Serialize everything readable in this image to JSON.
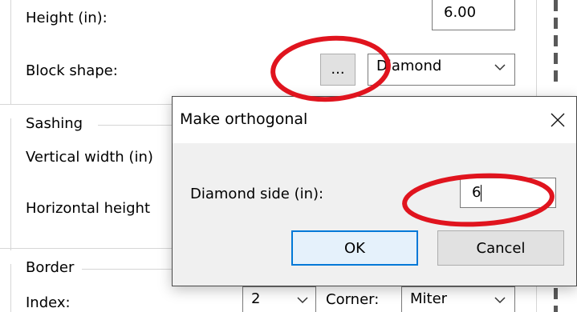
{
  "settings": {
    "height_label": "Height (in):",
    "height_value": "6.00",
    "block_shape_label": "Block shape:",
    "ellipsis_label": "...",
    "block_shape_value": "Diamond",
    "sashing_group": "Sashing",
    "vertical_width_label": "Vertical width (in)",
    "horizontal_height_label": "Horizontal height",
    "border_group": "Border",
    "index_label": "Index:",
    "index_value": "2",
    "corner_label": "Corner:",
    "corner_value": "Miter"
  },
  "dialog": {
    "title": "Make orthogonal",
    "close_label": "✕",
    "side_label": "Diamond side (in):",
    "side_value": "6",
    "ok_label": "OK",
    "cancel_label": "Cancel"
  },
  "annotation_color": "#e0141e",
  "icons": [
    "chevron-down-icon",
    "close-icon"
  ]
}
